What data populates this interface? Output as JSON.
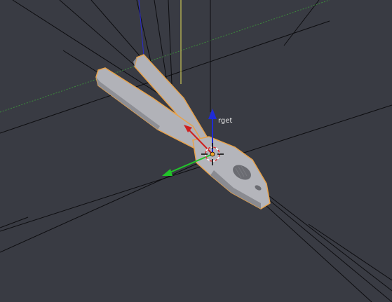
{
  "viewport": {
    "target_label": "rget",
    "colors": {
      "background": "#393b43",
      "mesh": "#b1b2b8",
      "mesh_outline": "#e8a24a",
      "x_axis": "#cf1f1f",
      "y_axis": "#22c42a",
      "z_axis": "#1f2bd6",
      "grid_line": "#0d0d10",
      "label_text": "#e0e0e0"
    }
  },
  "icons": {
    "manipulator": "transform-manipulator-icon",
    "pivot": "3d-cursor-icon",
    "object": "pliers-mesh-icon"
  }
}
